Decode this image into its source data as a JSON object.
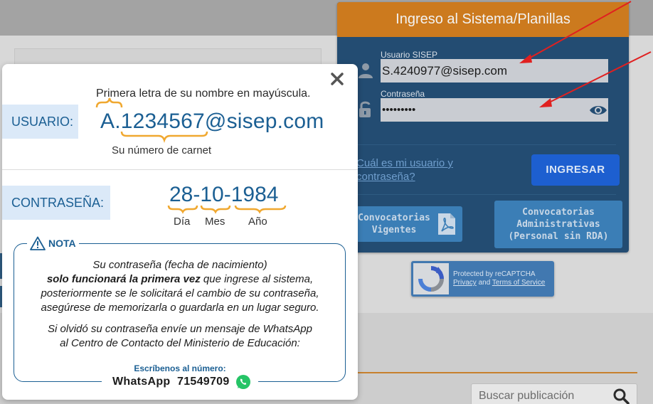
{
  "login": {
    "title": "Ingreso al Sistema/Planillas",
    "user_label": "Usuario SISEP",
    "user_value": "S.4240977@sisep.com",
    "password_label": "Contraseña",
    "password_value": "•••••••••",
    "help_link": "Cuál es mi usuario y contraseña?",
    "submit": "INGRESAR",
    "convocatorias_vigentes": "Convocatorias Vigentes",
    "convocatorias_admin": "Convocatorias Administrativas (Personal sin RDA)"
  },
  "recaptcha": {
    "line1": "Protected by reCAPTCHA",
    "privacy": "Privacy",
    "and": "and",
    "terms": "Terms of Service"
  },
  "search": {
    "placeholder": "Buscar publicación"
  },
  "modal": {
    "usuario_tag": "USUARIO:",
    "usuario_hint": "Primera letra de su nombre en mayúscula.",
    "usuario_example": "A.1234567@sisep.com",
    "usuario_carnet": "Su número de carnet",
    "contrasena_tag": "CONTRASEÑA:",
    "contrasena_example": "28-10-1984",
    "dia": "Día",
    "mes": "Mes",
    "ano": "Año",
    "nota_title": "NOTA",
    "nota_line1": "Su contraseña (fecha de nacimiento)",
    "nota_bold": "solo funcionará la primera vez",
    "nota_line2_rest": " que ingrese al sistema,",
    "nota_line3": "posteriormente se le solicitará el cambio de su contraseña,",
    "nota_line4": "asegúrese de memorizarla o guardarla en un lugar seguro.",
    "olvido_line1": "Si olvidó su contraseña envíe un mensaje de WhatsApp",
    "olvido_line2": "al Centro de Contacto del Ministerio de Educación:",
    "escribenos": "Escríbenos al número:",
    "whatsapp": "WhatsApp  71549709"
  },
  "colors": {
    "login_header": "#cc7a1e",
    "login_panel": "#234c72",
    "ingresar_button": "#1d5fd0",
    "modal_accent": "#1b5f93",
    "arrow_red": "#e02020",
    "whatsapp_green": "#25c466"
  },
  "icons": [
    "user-icon",
    "lock-icon",
    "eye-icon",
    "pdf-icon",
    "close-icon",
    "warning-icon",
    "whatsapp-icon",
    "search-icon",
    "recaptcha-logo"
  ]
}
